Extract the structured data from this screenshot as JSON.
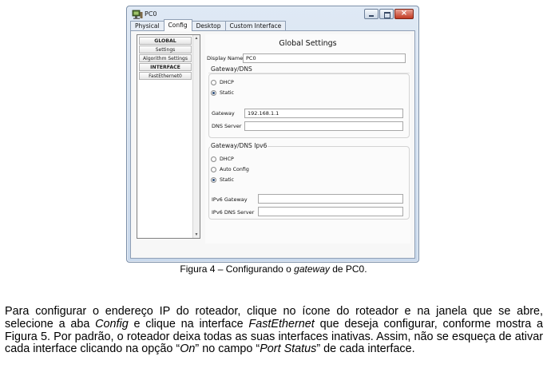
{
  "window": {
    "title": "PC0",
    "controls": {
      "close_glyph": "×"
    }
  },
  "tabs": [
    "Physical",
    "Config",
    "Desktop",
    "Custom Interface"
  ],
  "active_tab": "Config",
  "sidebar": {
    "items": [
      "GLOBAL",
      "Settings",
      "Algorithm Settings",
      "INTERFACE",
      "FastEthernet0"
    ],
    "scroll_up": "▲",
    "scroll_down": "▼"
  },
  "global_settings": {
    "title": "Global Settings",
    "display_name_label": "Display Name",
    "display_name_value": "PC0",
    "gateway_dns": {
      "title": "Gateway/DNS",
      "options": [
        "DHCP",
        "Static"
      ],
      "selected": "Static",
      "gateway_label": "Gateway",
      "gateway_value": "192.168.1.1",
      "dns_label": "DNS Server",
      "dns_value": ""
    },
    "gateway_dns_ipv6": {
      "title": "Gateway/DNS Ipv6",
      "options": [
        "DHCP",
        "Auto Config",
        "Static"
      ],
      "selected": "Static",
      "gateway_label": "IPv6 Gateway",
      "gateway_value": "",
      "dns_label": "IPv6 DNS Server",
      "dns_value": ""
    }
  },
  "caption": {
    "prefix": "Figura 4 – Configurando o ",
    "italic": "gateway",
    "suffix": " de PC0."
  },
  "paragraph": {
    "t1": "Para configurar o endereço IP do roteador, clique no ícone do roteador e na janela que se abre, selecione a aba ",
    "i1": "Config",
    "t2": " e clique na interface ",
    "i2": "FastEthernet",
    "t3": " que deseja configurar, conforme mostra a Figura 5. Por padrão, o roteador deixa todas as suas interfaces inativas. Assim, não se esqueça de ativar cada interface clicando na opção “",
    "i3": "On",
    "t4": "” no campo “",
    "i4": "Port Status",
    "t5": "” de cada interface."
  }
}
